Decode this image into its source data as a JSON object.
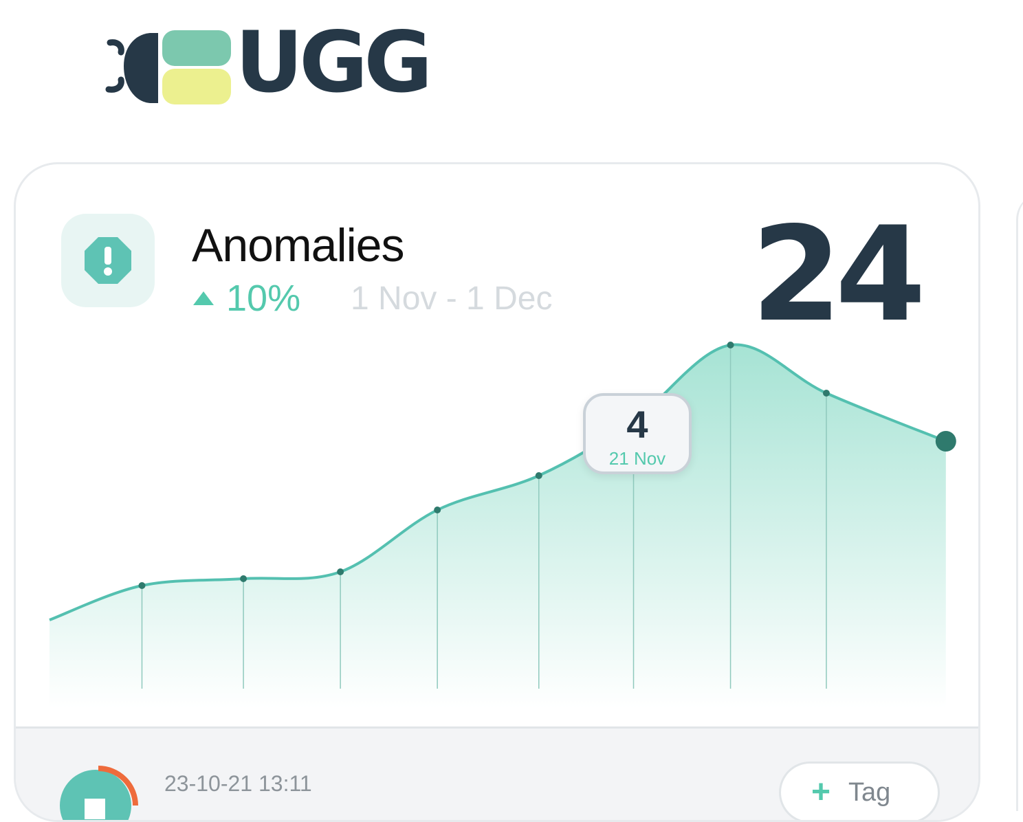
{
  "app": {
    "logo_text": "UGG"
  },
  "card": {
    "title": "Anomalies",
    "change_percent": "10%",
    "change_direction": "up",
    "date_range": "1 Nov - 1 Dec",
    "count": "24",
    "icon": "alert-octagon-icon"
  },
  "chart_data": {
    "type": "area",
    "points": [
      0.0,
      0.82,
      1.72,
      2.58,
      3.44,
      4.34,
      5.18,
      6.04,
      6.89,
      7.95
    ],
    "values": [
      0.6,
      1.1,
      1.2,
      1.3,
      2.2,
      2.7,
      3.5,
      4.6,
      3.9,
      3.2
    ],
    "highlight": {
      "label": "4",
      "date": "21 Nov"
    },
    "colors": {
      "line": "#54c0b0",
      "fill": "#a8e4d6",
      "marker": "#2f7a6d"
    }
  },
  "footer": {
    "timestamp": "23-10-21 13:11",
    "tag_label": "Tag",
    "tag_icon": "plus-icon"
  },
  "colors": {
    "accent": "#54c9ad",
    "dark": "#263847",
    "muted": "#d5dade"
  }
}
